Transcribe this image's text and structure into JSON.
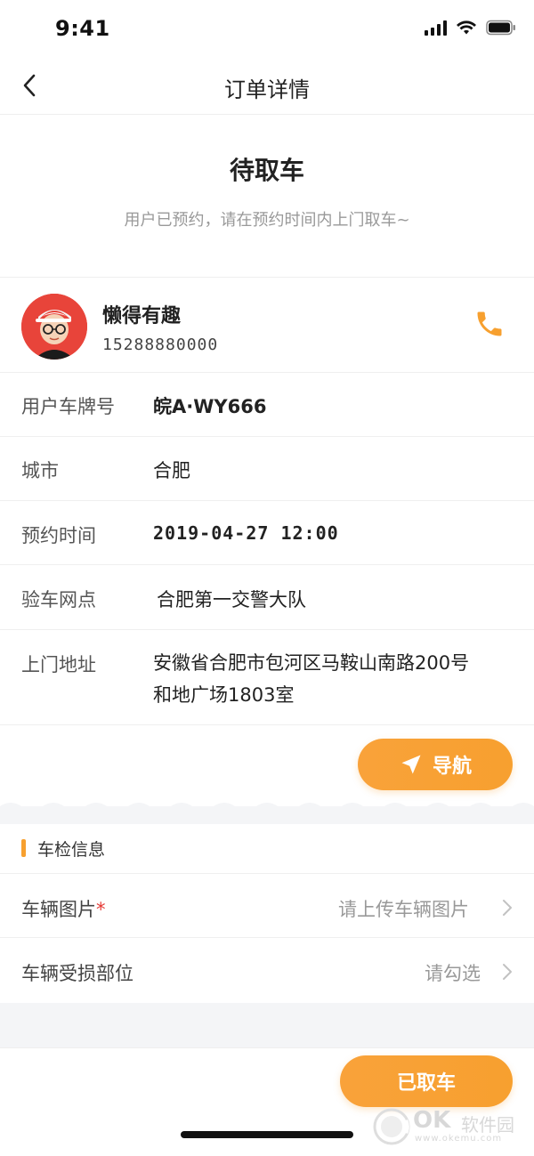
{
  "status_bar": {
    "time": "9:41"
  },
  "nav": {
    "title": "订单详情"
  },
  "order": {
    "status": "待取车",
    "hint": "用户已预约，请在预约时间内上门取车~"
  },
  "user": {
    "name": "懒得有趣",
    "phone": "15288880000"
  },
  "details": {
    "plate_label": "用户车牌号",
    "plate_value": "皖A·WY666",
    "city_label": "城市",
    "city_value": "合肥",
    "time_label": "预约时间",
    "time_value": "2019-04-27 12:00",
    "station_label": "验车网点",
    "station_value": "合肥第一交警大队",
    "address_label": "上门地址",
    "address_line1": "安徽省合肥市包河区马鞍山南路200号",
    "address_line2": "和地广场1803室"
  },
  "navigate_button": {
    "label": "导航"
  },
  "inspection": {
    "section_title": "车检信息",
    "photos_label": "车辆图片",
    "photos_required": "*",
    "photos_value": "请上传车辆图片",
    "damage_label": "车辆受损部位",
    "damage_value": "请勾选"
  },
  "picked_button": {
    "label": "已取车"
  },
  "watermark": {
    "brand": "OK",
    "cn": "软件园",
    "url": "www.okemu.com"
  },
  "colors": {
    "accent": "#f7a02f",
    "required": "#e53935",
    "avatar_bg": "#e8443a"
  },
  "icons": {
    "back": "chevron-left-icon",
    "phone": "phone-icon",
    "navigate": "navigation-arrow-icon",
    "chevron": "chevron-right-icon"
  }
}
